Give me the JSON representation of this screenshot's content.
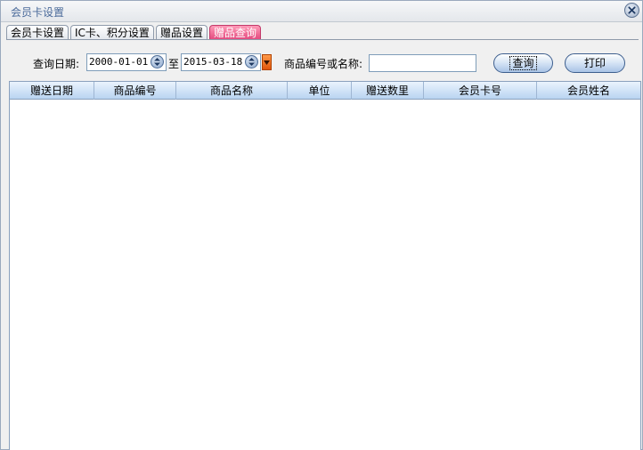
{
  "window": {
    "title": "会员卡设置"
  },
  "tabs": [
    {
      "label": "会员卡设置"
    },
    {
      "label": "IC卡、积分设置"
    },
    {
      "label": "赠品设置"
    },
    {
      "label": "赠品查询"
    }
  ],
  "filter": {
    "date_label": "查询日期:",
    "date_from": "2000-01-01",
    "to_label": "至",
    "date_to": "2015-03-18",
    "product_label": "商品编号或名称:",
    "product_value": ""
  },
  "buttons": {
    "query": "查询",
    "print": "打印"
  },
  "table": {
    "columns": [
      "赠送日期",
      "商品编号",
      "商品名称",
      "单位",
      "赠送数里",
      "会员卡号",
      "会员姓名"
    ],
    "rows": []
  },
  "colors": {
    "active_tab": "#e2467c",
    "header_blue": "#b9d4f1",
    "title_text": "#4a6a9a"
  }
}
